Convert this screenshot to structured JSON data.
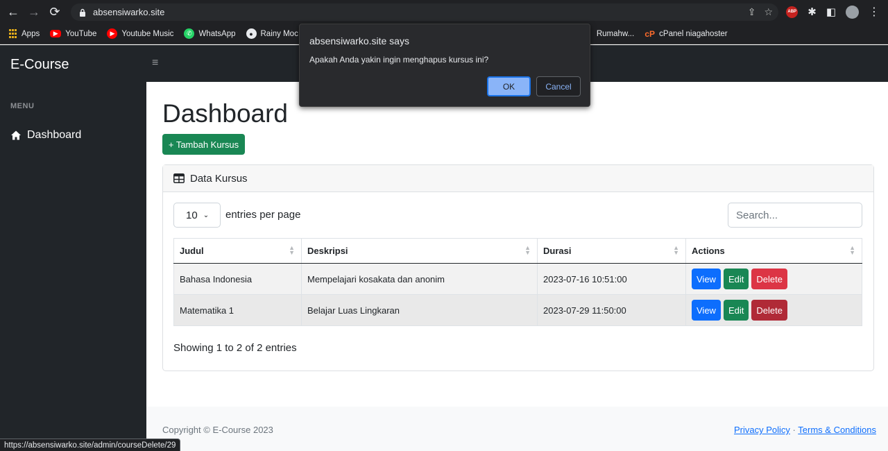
{
  "browser": {
    "url": "absensiwarko.site",
    "status_url": "https://absensiwarko.site/admin/courseDelete/29",
    "bookmarks": [
      {
        "label": "Apps",
        "icon": "apps-grid-icon"
      },
      {
        "label": "YouTube",
        "icon": "youtube-icon"
      },
      {
        "label": "Youtube Music",
        "icon": "youtube-music-icon"
      },
      {
        "label": "WhatsApp",
        "icon": "whatsapp-icon"
      },
      {
        "label": "Rainy Moc",
        "icon": "rainy-icon"
      },
      {
        "label": "Rumahw...",
        "icon": ""
      },
      {
        "label": "cPanel niagahoster",
        "icon": "cpanel-icon"
      }
    ],
    "extension_badge": "ABP"
  },
  "dialog": {
    "title": "absensiwarko.site says",
    "message": "Apakah Anda yakin ingin menghapus kursus ini?",
    "ok_label": "OK",
    "cancel_label": "Cancel"
  },
  "app": {
    "brand": "E-Course",
    "hamburger": "≡",
    "menu_heading": "MENU",
    "nav_item": "Dashboard"
  },
  "main": {
    "title": "Dashboard",
    "add_button": "+ Tambah Kursus",
    "card_title": "Data Kursus",
    "entries_value": "10",
    "entries_label": "entries per page",
    "search_placeholder": "Search...",
    "columns": [
      "Judul",
      "Deskripsi",
      "Durasi",
      "Actions"
    ],
    "rows": [
      {
        "judul": "Bahasa Indonesia",
        "deskripsi": "Mempelajari kosakata dan anonim",
        "durasi": "2023-07-16 10:51:00"
      },
      {
        "judul": "Matematika 1",
        "deskripsi": "Belajar Luas Lingkaran",
        "durasi": "2023-07-29 11:50:00"
      }
    ],
    "action_labels": {
      "view": "View",
      "edit": "Edit",
      "delete": "Delete"
    },
    "showing": "Showing 1 to 2 of 2 entries"
  },
  "footer": {
    "copyright": "Copyright © E-Course 2023",
    "privacy": "Privacy Policy",
    "separator": "·",
    "terms": "Terms & Conditions"
  },
  "colors": {
    "sidebar": "#212529",
    "primary": "#0d6efd",
    "success": "#198754",
    "danger": "#dc3545"
  }
}
